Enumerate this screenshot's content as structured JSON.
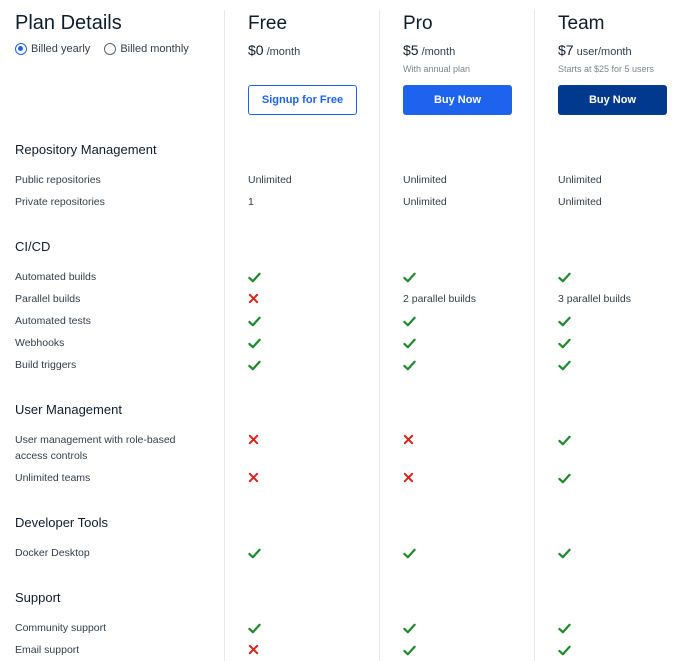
{
  "header": {
    "title": "Plan Details",
    "billing_options": [
      {
        "label": "Billed yearly",
        "selected": true
      },
      {
        "label": "Billed monthly",
        "selected": false
      }
    ]
  },
  "plans": [
    {
      "name": "Free",
      "price": "$0",
      "per": "/month",
      "note": "",
      "button": "Signup for Free"
    },
    {
      "name": "Pro",
      "price": "$5",
      "per": "/month",
      "note": "With annual plan",
      "button": "Buy Now"
    },
    {
      "name": "Team",
      "price": "$7",
      "per": "user/month",
      "note": "Starts at $25 for 5 users",
      "button": "Buy Now"
    }
  ],
  "sections": [
    {
      "title": "Repository Management",
      "rows": [
        {
          "feature": "Public repositories",
          "values": [
            "Unlimited",
            "Unlimited",
            "Unlimited"
          ]
        },
        {
          "feature": "Private repositories",
          "values": [
            "1",
            "Unlimited",
            "Unlimited"
          ]
        }
      ]
    },
    {
      "title": "CI/CD",
      "rows": [
        {
          "feature": "Automated builds",
          "values": [
            "check",
            "check",
            "check"
          ]
        },
        {
          "feature": "Parallel builds",
          "values": [
            "cross",
            "2 parallel builds",
            "3 parallel builds"
          ]
        },
        {
          "feature": "Automated tests",
          "values": [
            "check",
            "check",
            "check"
          ]
        },
        {
          "feature": "Webhooks",
          "values": [
            "check",
            "check",
            "check"
          ]
        },
        {
          "feature": "Build triggers",
          "values": [
            "check",
            "check",
            "check"
          ]
        }
      ]
    },
    {
      "title": "User Management",
      "rows": [
        {
          "feature": "User management with role-based",
          "feature_line2": "access controls",
          "values": [
            "cross",
            "cross",
            "check"
          ]
        },
        {
          "feature": "Unlimited teams",
          "values": [
            "cross",
            "cross",
            "check"
          ]
        }
      ]
    },
    {
      "title": "Developer Tools",
      "rows": [
        {
          "feature": "Docker Desktop",
          "values": [
            "check",
            "check",
            "check"
          ]
        }
      ]
    },
    {
      "title": "Support",
      "rows": [
        {
          "feature": "Community support",
          "values": [
            "check",
            "check",
            "check"
          ]
        },
        {
          "feature": "Email support",
          "values": [
            "cross",
            "check",
            "check"
          ]
        }
      ]
    }
  ],
  "colors": {
    "check": "#1f8a2e",
    "cross": "#e0201b",
    "accent": "#1d63ed",
    "team_button": "#00398e"
  }
}
